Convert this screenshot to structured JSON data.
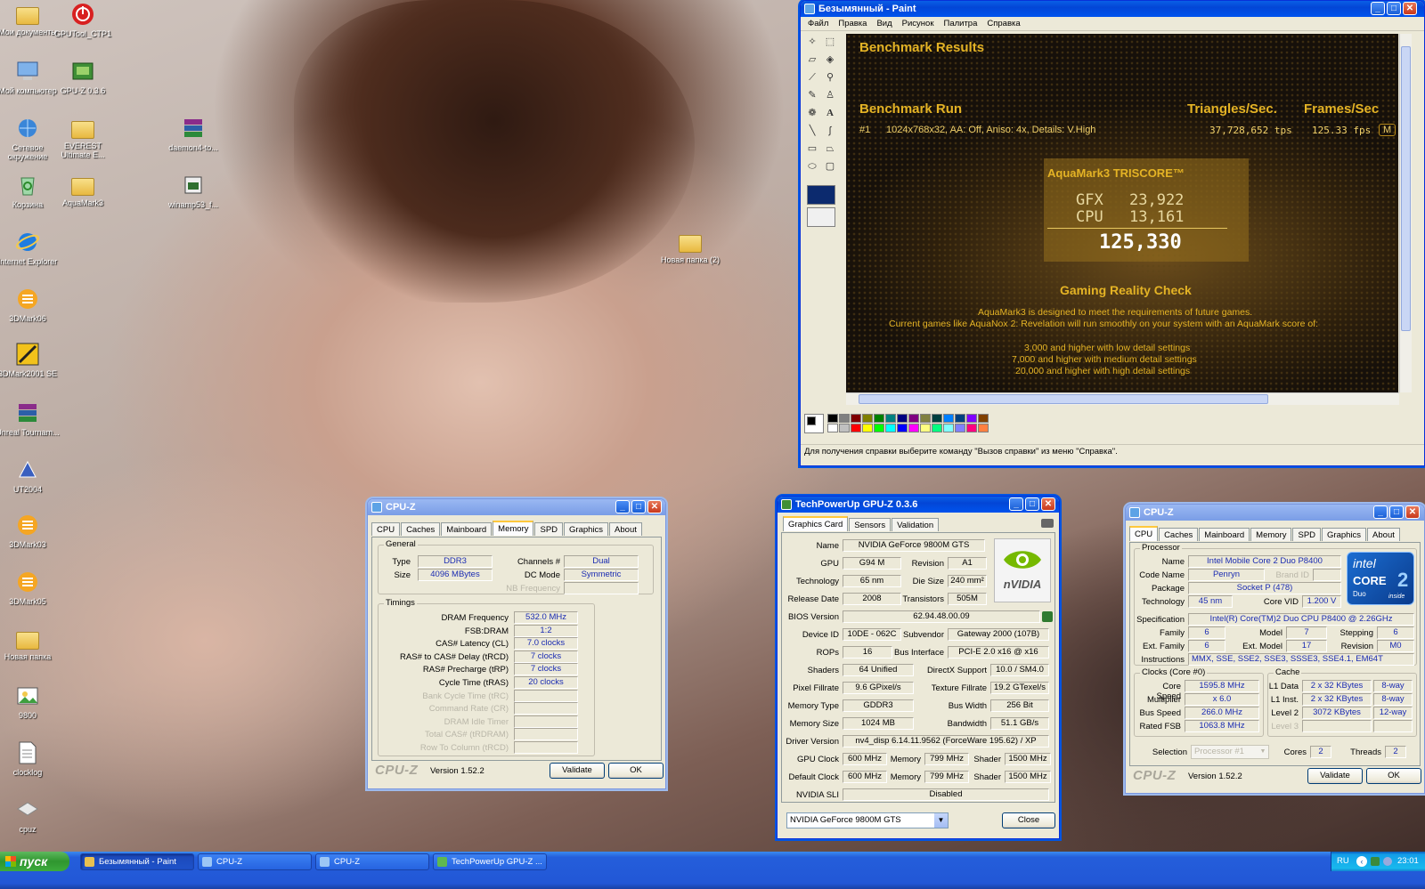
{
  "desktop": {
    "icons": [
      {
        "label": "Мои документы",
        "glyph": "folder-docs"
      },
      {
        "label": "GPUTool_CTP1",
        "glyph": "power"
      },
      {
        "label": "Мой компьютер",
        "glyph": "computer"
      },
      {
        "label": "GPU-Z 0.3.6",
        "glyph": "gpuz"
      },
      {
        "label": "Сетевое окружение",
        "glyph": "network"
      },
      {
        "label": "EVEREST Ultimate E...",
        "glyph": "folder"
      },
      {
        "label": "daemon4-to...",
        "glyph": "archive"
      },
      {
        "label": "Корзина",
        "glyph": "recycle"
      },
      {
        "label": "AquaMark3",
        "glyph": "folder"
      },
      {
        "label": "winamp53_f...",
        "glyph": "installer"
      },
      {
        "label": "Internet Explorer",
        "glyph": "ie"
      },
      {
        "label": "3DMark06",
        "glyph": "3dmark"
      },
      {
        "label": "3DMark2001 SE",
        "glyph": "3dmark2001"
      },
      {
        "label": "Unreal Tournam...",
        "glyph": "archive"
      },
      {
        "label": "UT2004",
        "glyph": "ut"
      },
      {
        "label": "3DMark03",
        "glyph": "3dmark"
      },
      {
        "label": "3DMark05",
        "glyph": "3dmark"
      },
      {
        "label": "Новая папка",
        "glyph": "folder"
      },
      {
        "label": "9800",
        "glyph": "image"
      },
      {
        "label": "clocklog",
        "glyph": "txt"
      },
      {
        "label": "cpuz",
        "glyph": "cpuz"
      },
      {
        "label": "Новая папка (2)",
        "glyph": "folder"
      }
    ]
  },
  "paint": {
    "title": "Безымянный - Paint",
    "menu": [
      "Файл",
      "Правка",
      "Вид",
      "Рисунок",
      "Палитра",
      "Справка"
    ],
    "status": "Для получения справки выберите команду \"Вызов справки\" из меню \"Справка\".",
    "image": {
      "heading": "Benchmark Results",
      "run_label": "Benchmark Run",
      "tri_label": "Triangles/Sec.",
      "fps_label": "Frames/Sec",
      "row_num": "#1",
      "row_desc": "1024x768x32, AA: Off, Aniso: 4x, Details: V.High",
      "row_tps": "37,728,652 tps",
      "row_fps": "125.33 fps",
      "row_more": "M",
      "triscore_title": "AquaMark3 TRISCORE™",
      "gfx_label": "GFX",
      "gfx_val": "23,922",
      "cpu_label": "CPU",
      "cpu_val": "13,161",
      "total": "125,330",
      "grc_title": "Gaming Reality Check",
      "grc_1": "AquaMark3 is designed to meet the requirements of future games.",
      "grc_2": "Current games like AquaNox 2: Revelation will run smoothly on your system with an AquaMark score of:",
      "grc_3": "3,000 and higher with low detail settings",
      "grc_4": "7,000 and higher with medium detail settings",
      "grc_5": "20,000 and higher with high detail settings"
    },
    "palette": [
      "#000000",
      "#808080",
      "#800000",
      "#808000",
      "#008000",
      "#008080",
      "#000080",
      "#800080",
      "#808040",
      "#004040",
      "#0080ff",
      "#004080",
      "#8000ff",
      "#804000",
      "#ffffff",
      "#c0c0c0",
      "#ff0000",
      "#ffff00",
      "#00ff00",
      "#00ffff",
      "#0000ff",
      "#ff00ff",
      "#ffff80",
      "#00ff80",
      "#80ffff",
      "#8080ff",
      "#ff0080",
      "#ff8040"
    ]
  },
  "cpuz_mem": {
    "title": "CPU-Z",
    "tabs": [
      "CPU",
      "Caches",
      "Mainboard",
      "Memory",
      "SPD",
      "Graphics",
      "About"
    ],
    "active_tab": "Memory",
    "general_title": "General",
    "type_label": "Type",
    "type": "DDR3",
    "size_label": "Size",
    "size": "4096 MBytes",
    "channels_label": "Channels #",
    "channels": "Dual",
    "dc_label": "DC Mode",
    "dc": "Symmetric",
    "nb_label": "NB Frequency",
    "nb": "",
    "timings_title": "Timings",
    "timings": [
      {
        "label": "DRAM Frequency",
        "value": "532.0 MHz",
        "dim": false
      },
      {
        "label": "FSB:DRAM",
        "value": "1:2",
        "dim": false
      },
      {
        "label": "CAS# Latency (CL)",
        "value": "7.0 clocks",
        "dim": false
      },
      {
        "label": "RAS# to CAS# Delay (tRCD)",
        "value": "7 clocks",
        "dim": false
      },
      {
        "label": "RAS# Precharge (tRP)",
        "value": "7 clocks",
        "dim": false
      },
      {
        "label": "Cycle Time (tRAS)",
        "value": "20 clocks",
        "dim": false
      },
      {
        "label": "Bank Cycle Time (tRC)",
        "value": "",
        "dim": true
      },
      {
        "label": "Command Rate (CR)",
        "value": "",
        "dim": true
      },
      {
        "label": "DRAM Idle Timer",
        "value": "",
        "dim": true
      },
      {
        "label": "Total CAS# (tRDRAM)",
        "value": "",
        "dim": true
      },
      {
        "label": "Row To Column (tRCD)",
        "value": "",
        "dim": true
      }
    ],
    "brand": "CPU-Z",
    "version": "Version 1.52.2",
    "validate": "Validate",
    "ok": "OK"
  },
  "gpuz": {
    "title": "TechPowerUp GPU-Z 0.3.6",
    "tabs": [
      "Graphics Card",
      "Sensors",
      "Validation"
    ],
    "name_label": "Name",
    "name": "NVIDIA GeForce 9800M GTS",
    "gpu_label": "GPU",
    "gpu": "G94 M",
    "rev_label": "Revision",
    "rev": "A1",
    "tech_label": "Technology",
    "tech": "65 nm",
    "die_label": "Die Size",
    "die": "240 mm²",
    "rel_label": "Release Date",
    "rel": "2008",
    "trans_label": "Transistors",
    "trans": "505M",
    "bios_label": "BIOS Version",
    "bios": "62.94.48.00.09",
    "dev_label": "Device ID",
    "dev": "10DE - 062C",
    "sub_label": "Subvendor",
    "sub": "Gateway 2000 (107B)",
    "rops_label": "ROPs",
    "rops": "16",
    "bus_label": "Bus Interface",
    "bus": "PCI-E 2.0 x16 @ x16",
    "sh_label": "Shaders",
    "sh": "64 Unified",
    "dx_label": "DirectX Support",
    "dx": "10.0 / SM4.0",
    "pf_label": "Pixel Fillrate",
    "pf": "9.6 GPixel/s",
    "tf_label": "Texture Fillrate",
    "tf": "19.2 GTexel/s",
    "mt_label": "Memory Type",
    "mt": "GDDR3",
    "bw_label": "Bus Width",
    "bw": "256 Bit",
    "ms_label": "Memory Size",
    "ms": "1024 MB",
    "band_label": "Bandwidth",
    "band": "51.1 GB/s",
    "drv_label": "Driver Version",
    "drv": "nv4_disp 6.14.11.9562 (ForceWare 195.62) / XP",
    "gc_label": "GPU Clock",
    "gc": "600 MHz",
    "mem_label": "Memory",
    "gc_mem": "799 MHz",
    "shader_label": "Shader",
    "gc_sh": "1500 MHz",
    "dc_label": "Default Clock",
    "dc": "600 MHz",
    "dc_mem": "799 MHz",
    "dc_sh": "1500 MHz",
    "sli_label": "NVIDIA SLI",
    "sli": "Disabled",
    "select": "NVIDIA GeForce 9800M GTS",
    "close": "Close",
    "logo": "nVIDIA"
  },
  "cpuz_cpu": {
    "title": "CPU-Z",
    "tabs": [
      "CPU",
      "Caches",
      "Mainboard",
      "Memory",
      "SPD",
      "Graphics",
      "About"
    ],
    "active_tab": "CPU",
    "proc_title": "Processor",
    "name_label": "Name",
    "name": "Intel Mobile Core 2 Duo P8400",
    "code_label": "Code Name",
    "code": "Penryn",
    "brand_id_label": "Brand ID",
    "pkg_label": "Package",
    "pkg": "Socket P (478)",
    "tech_label": "Technology",
    "tech": "45 nm",
    "vid_label": "Core VID",
    "vid": "1.200 V",
    "spec_label": "Specification",
    "spec": "Intel(R) Core(TM)2 Duo CPU    P8400  @ 2.26GHz",
    "fam_label": "Family",
    "fam": "6",
    "model_label": "Model",
    "model": "7",
    "step_label": "Stepping",
    "step": "6",
    "efam_label": "Ext. Family",
    "efam": "6",
    "emodel_label": "Ext. Model",
    "emodel": "17",
    "rev_label": "Revision",
    "rev": "M0",
    "instr_label": "Instructions",
    "instr": "MMX, SSE, SSE2, SSE3, SSSE3, SSE4.1, EM64T",
    "clocks_title": "Clocks (Core #0)",
    "cs_label": "Core Speed",
    "cs": "1595.8 MHz",
    "mult_label": "Multiplier",
    "mult": "x 6.0",
    "bs_label": "Bus Speed",
    "bs": "266.0 MHz",
    "fsb_label": "Rated FSB",
    "fsb": "1063.8 MHz",
    "cache_title": "Cache",
    "l1d_label": "L1 Data",
    "l1d": "2 x 32 KBytes",
    "l1d_w": "8-way",
    "l1i_label": "L1 Inst.",
    "l1i": "2 x 32 KBytes",
    "l1i_w": "8-way",
    "l2_label": "Level 2",
    "l2": "3072 KBytes",
    "l2_w": "12-way",
    "l3_label": "Level 3",
    "sel_label": "Selection",
    "sel": "Processor #1",
    "cores_label": "Cores",
    "cores": "2",
    "threads_label": "Threads",
    "threads": "2",
    "logo_intel": "intel",
    "logo_core": "CORE",
    "logo_duo": "Duo",
    "logo_inside": "inside",
    "brand": "CPU-Z",
    "version": "Version 1.52.2",
    "validate": "Validate",
    "ok": "OK"
  },
  "taskbar": {
    "start": "пуск",
    "tasks": [
      "Безымянный - Paint",
      "CPU-Z",
      "CPU-Z",
      "TechPowerUp GPU-Z ..."
    ],
    "lang": "RU",
    "time": "23:01"
  }
}
